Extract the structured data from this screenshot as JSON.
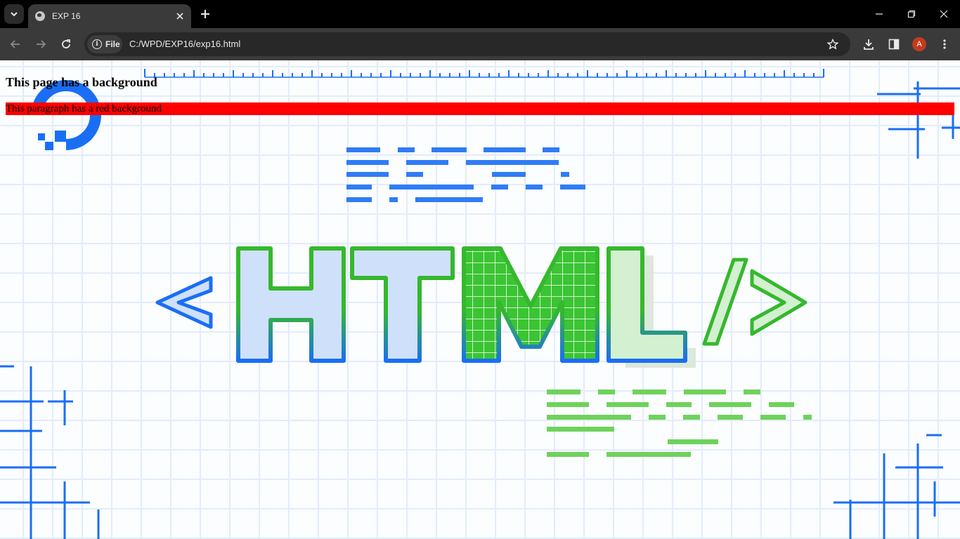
{
  "browser": {
    "tab_title": "EXP 16",
    "chip_label": "File",
    "url": "C:/WPD/EXP16/exp16.html",
    "avatar_initial": "A"
  },
  "page": {
    "heading": "This page has a background",
    "paragraph": "This paragraph has a red background",
    "paragraph_bg_color": "#ff0000",
    "background_art": {
      "description_text": "< HTML />",
      "primary_blue": "#1a6ef5",
      "primary_green": "#35b82d"
    }
  }
}
